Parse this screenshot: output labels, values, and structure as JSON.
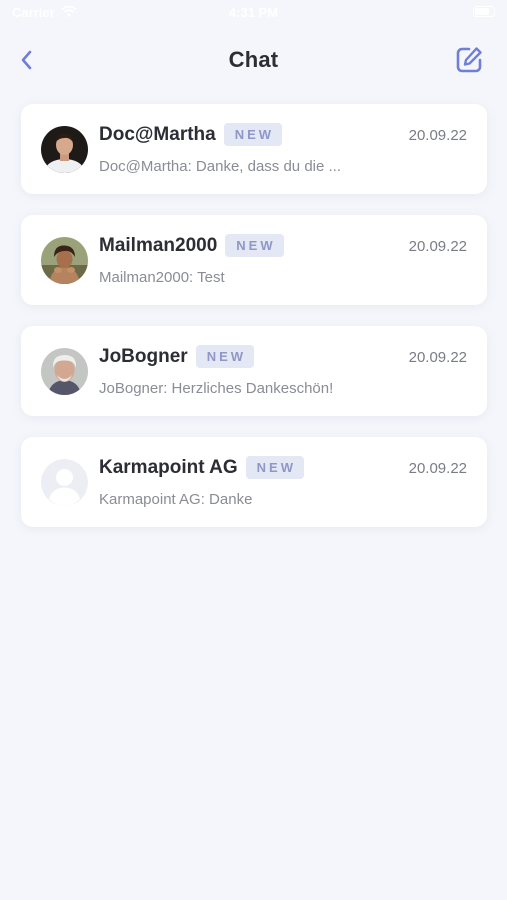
{
  "status_bar": {
    "carrier": "Carrier",
    "time": "4:31 PM"
  },
  "header": {
    "title": "Chat",
    "back_icon": "chevron-left-icon",
    "compose_icon": "edit-icon"
  },
  "colors": {
    "accent": "#6f7ed6",
    "background": "#f5f6fb",
    "badge_bg": "#e4e7f4",
    "badge_text": "#8f97c9"
  },
  "chats": [
    {
      "name": "Doc@Martha",
      "badge": "NEW",
      "date": "20.09.22",
      "preview": "Doc@Martha: Danke, dass du die ...",
      "avatar": "user-photo"
    },
    {
      "name": "Mailman2000",
      "badge": "NEW",
      "date": "20.09.22",
      "preview": "Mailman2000: Test",
      "avatar": "user-photo"
    },
    {
      "name": "JoBogner",
      "badge": "NEW",
      "date": "20.09.22",
      "preview": "JoBogner: Herzliches Dankeschön!",
      "avatar": "user-photo"
    },
    {
      "name": "Karmapoint AG",
      "badge": "NEW",
      "date": "20.09.22",
      "preview": "Karmapoint AG: Danke",
      "avatar": "default-avatar-icon"
    }
  ]
}
